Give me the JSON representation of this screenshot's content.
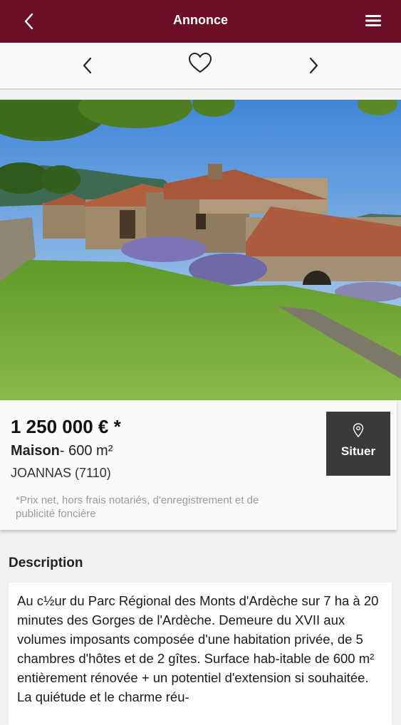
{
  "header": {
    "title": "Annonce"
  },
  "icons": {
    "back": "back-chevron-icon",
    "menu": "hamburger-menu-icon",
    "prev": "chevron-left-icon",
    "favorite": "heart-outline-icon",
    "next": "chevron-right-icon",
    "locate": "map-pin-icon"
  },
  "colors": {
    "header_bg": "#6b0f26",
    "situer_bg": "#3a3a3a"
  },
  "listing": {
    "price": "1 250 000 € *",
    "type": "Maison",
    "surface": "- 600 m²",
    "city": "JOANNAS (7110)",
    "note": "*Prix net, hors frais notariés, d'enregistrement et de publicité foncière",
    "situer_label": "Situer"
  },
  "description": {
    "title": "Description",
    "text": "Au c½ur du Parc Régional des Monts d'Ardèche sur 7 ha à 20 minutes des Gorges de l'Ardèche. Demeure du XVII aux volumes imposants composée d'une habitation privée, de 5 chambres d'hôtes et de 2 gîtes. Surface hab-itable de 600 m² entièrement rénovée + un potentiel d'extension si souhaitée. La quiétude et le charme réu-"
  }
}
